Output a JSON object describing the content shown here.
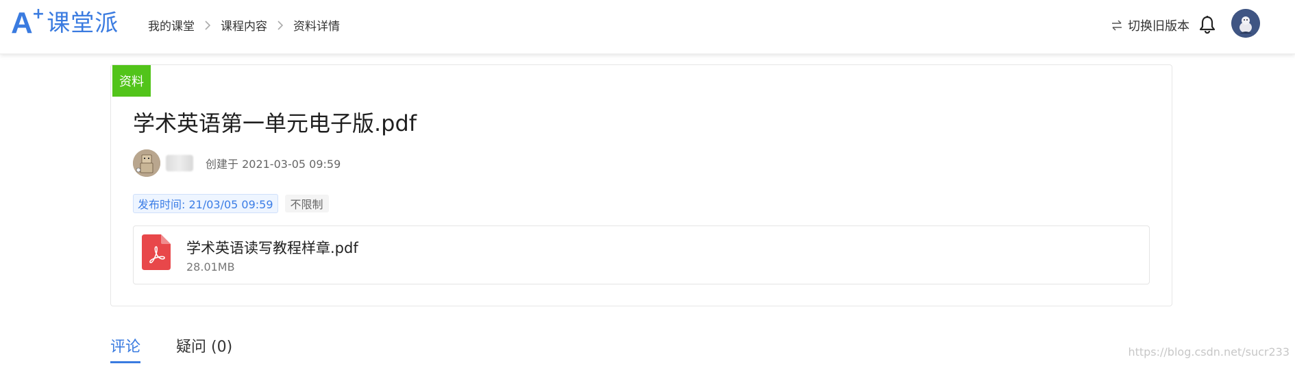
{
  "header": {
    "logo_a": "A",
    "logo_plus": "+",
    "logo_text": "课堂派",
    "breadcrumb": [
      "我的课堂",
      "课程内容",
      "资料详情"
    ],
    "switch_label": "切换旧版本",
    "icons": {
      "switch": "switch-arrows-icon",
      "bell": "bell-icon",
      "chevron": "chevron-right-icon"
    }
  },
  "doc": {
    "tag": "资料",
    "title": "学术英语第一单元电子版.pdf",
    "created": "创建于 2021-03-05 09:59",
    "publish_time": "发布时间: 21/03/05 09:59",
    "limit": "不限制",
    "file": {
      "name": "学术英语读写教程样章.pdf",
      "size": "28.01MB",
      "icon": "pdf-icon"
    }
  },
  "tabs": [
    {
      "label": "评论",
      "active": true
    },
    {
      "label": "疑问 (0)",
      "active": false
    }
  ],
  "watermark": "https://blog.csdn.net/sucr233",
  "colors": {
    "accent": "#3a7be0",
    "tag_green": "#52c41a",
    "pdf_red": "#e8474a"
  }
}
